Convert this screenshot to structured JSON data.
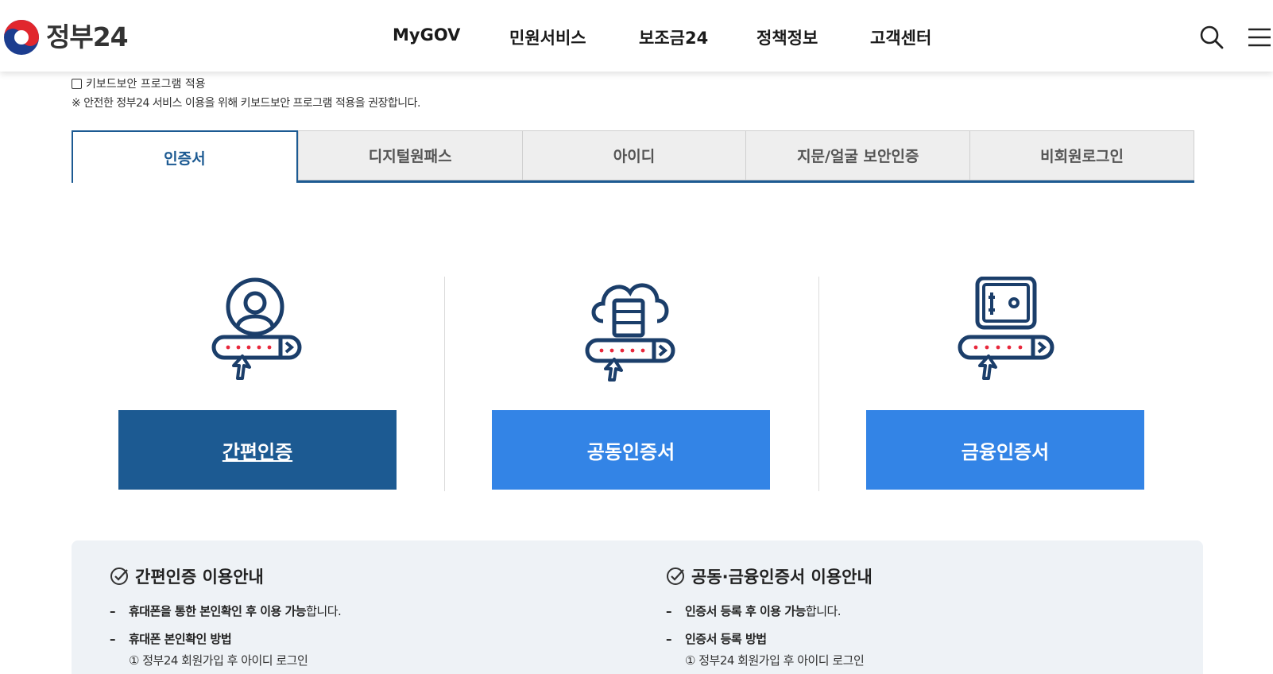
{
  "header": {
    "logo_text": "정부24",
    "nav": [
      "MyGOV",
      "민원서비스",
      "보조금24",
      "정책정보",
      "고객센터"
    ]
  },
  "keyboard": {
    "checkbox_label": "키보드보안 프로그램 적용",
    "note": "※ 안전한 정부24 서비스 이용을 위해 키보드보안 프로그램 적용을 권장합니다."
  },
  "tabs": [
    "인증서",
    "디지털원패스",
    "아이디",
    "지문/얼굴 보안인증",
    "비회원로그인"
  ],
  "cards": {
    "simple": "간편인증",
    "joint": "공동인증서",
    "financial": "금융인증서"
  },
  "info": {
    "left": {
      "title": "간편인증 이용안내",
      "item1_bold": "휴대폰을 통한 본인확인 후 이용 가능",
      "item1_rest": "합니다.",
      "item2_bold": "휴대폰 본인확인 방법",
      "sub": "① 정부24 회원가입 후 아이디 로그인"
    },
    "right": {
      "title": "공동·금융인증서 이용안내",
      "item1_bold": "인증서 등록 후 이용 가능",
      "item1_rest": "합니다.",
      "item2_bold": "인증서 등록 방법",
      "sub": "① 정부24 회원가입 후 아이디 로그인"
    }
  },
  "colors": {
    "primary_dark": "#1c5a92",
    "primary_light": "#3384e6",
    "accent_red": "#e8283c"
  }
}
